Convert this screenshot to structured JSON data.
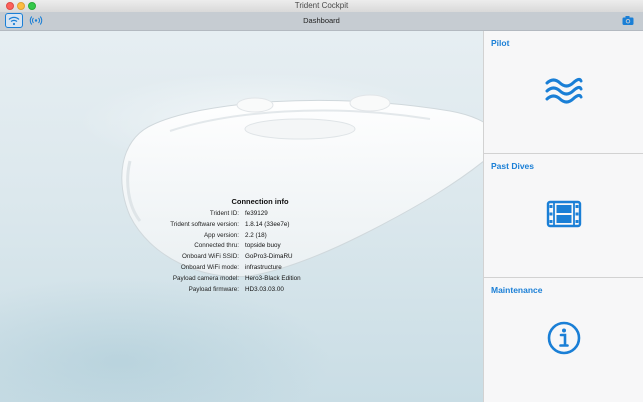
{
  "window": {
    "title": "Trident Cockpit"
  },
  "toolbar": {
    "title": "Dashboard",
    "icons": [
      "wifi-icon",
      "signal-icon",
      "camera-icon"
    ]
  },
  "connection_info": {
    "title": "Connection info",
    "rows": [
      {
        "label": "Trident ID:",
        "value": "fe39129"
      },
      {
        "label": "Trident software version:",
        "value": "1.8.14 (33ee7e)"
      },
      {
        "label": "App version:",
        "value": "2.2 (18)"
      },
      {
        "label": "Connected thru:",
        "value": "topside buoy"
      },
      {
        "label": "Onboard WiFi SSID:",
        "value": "GoPro3-DimaRU"
      },
      {
        "label": "Onboard WiFi mode:",
        "value": "infrastructure"
      },
      {
        "label": "Payload camera model:",
        "value": "Hero3-Black Edition"
      },
      {
        "label": "Payload firmware:",
        "value": "HD3.03.03.00"
      }
    ]
  },
  "sidebar": {
    "panels": [
      {
        "title": "Pilot",
        "icon": "waves-icon"
      },
      {
        "title": "Past Dives",
        "icon": "film-icon"
      },
      {
        "title": "Maintenance",
        "icon": "info-icon"
      }
    ]
  },
  "colors": {
    "accent": "#1a7fd6",
    "toolbar": "#c6ccd2"
  }
}
